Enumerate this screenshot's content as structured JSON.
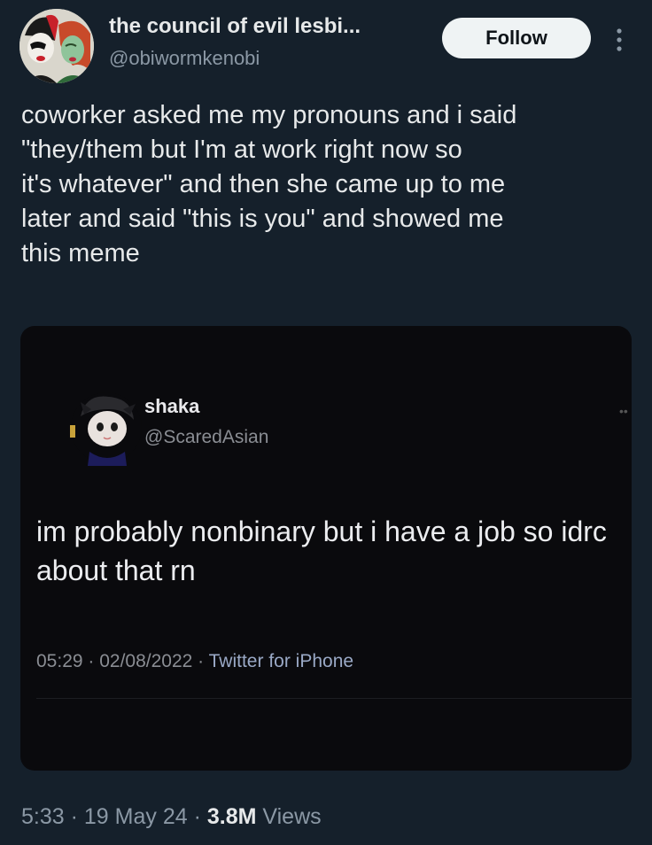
{
  "author": {
    "display_name": "the council of evil lesbi...",
    "handle": "@obiwormkenobi"
  },
  "actions": {
    "follow_label": "Follow",
    "more_icon": "more-vertical-icon"
  },
  "tweet": {
    "text": "coworker asked me my pronouns and i said\n\"they/them but I'm at work right now so\nit's whatever\" and then she came up to me\nlater and said \"this is you\" and showed me\nthis meme"
  },
  "embedded": {
    "name": "shaka",
    "handle": "@ScaredAsian",
    "text": "im probably nonbinary but i have a job so idrc about that rn",
    "time": "05:29",
    "date": "02/08/2022",
    "source": "Twitter for iPhone",
    "sep": " · "
  },
  "footer": {
    "time": "5:33",
    "sep": " · ",
    "date": "19 May 24",
    "views_count": "3.8M",
    "views_label": " Views"
  },
  "colors": {
    "background": "#15202b",
    "text": "#e7e9ea",
    "secondary": "#8b98a5",
    "follow_bg": "#eff3f4"
  }
}
